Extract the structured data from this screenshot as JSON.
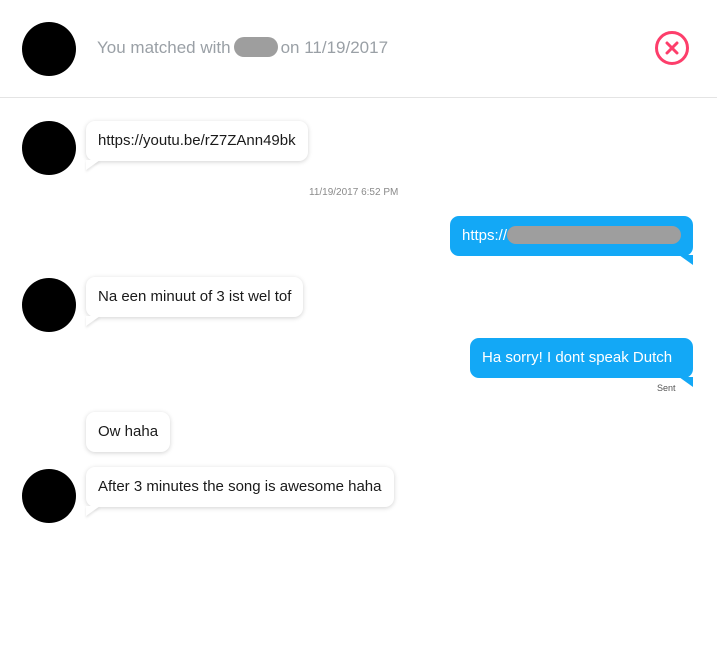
{
  "header": {
    "matched_prefix": "You matched with",
    "matched_suffix": "on 11/19/2017",
    "close_icon": "close-circle-icon"
  },
  "messages": [
    {
      "direction": "incoming",
      "text": "https://youtu.be/rZ7ZAnn49bk"
    },
    {
      "direction": "outgoing",
      "text": "https://",
      "redacted": true
    },
    {
      "direction": "incoming",
      "text": "Na een minuut of 3 ist wel tof"
    },
    {
      "direction": "outgoing",
      "text": "Ha sorry! I dont speak Dutch"
    },
    {
      "direction": "incoming",
      "text": "Ow haha"
    },
    {
      "direction": "incoming",
      "text": "After 3 minutes the song is awesome haha"
    }
  ],
  "timestamp": "11/19/2017 6:52 PM",
  "sent_status": "Sent",
  "colors": {
    "accent": "#fd3e6b",
    "outgoing_bubble": "#13a8f6",
    "header_text": "#9aa0a6"
  }
}
